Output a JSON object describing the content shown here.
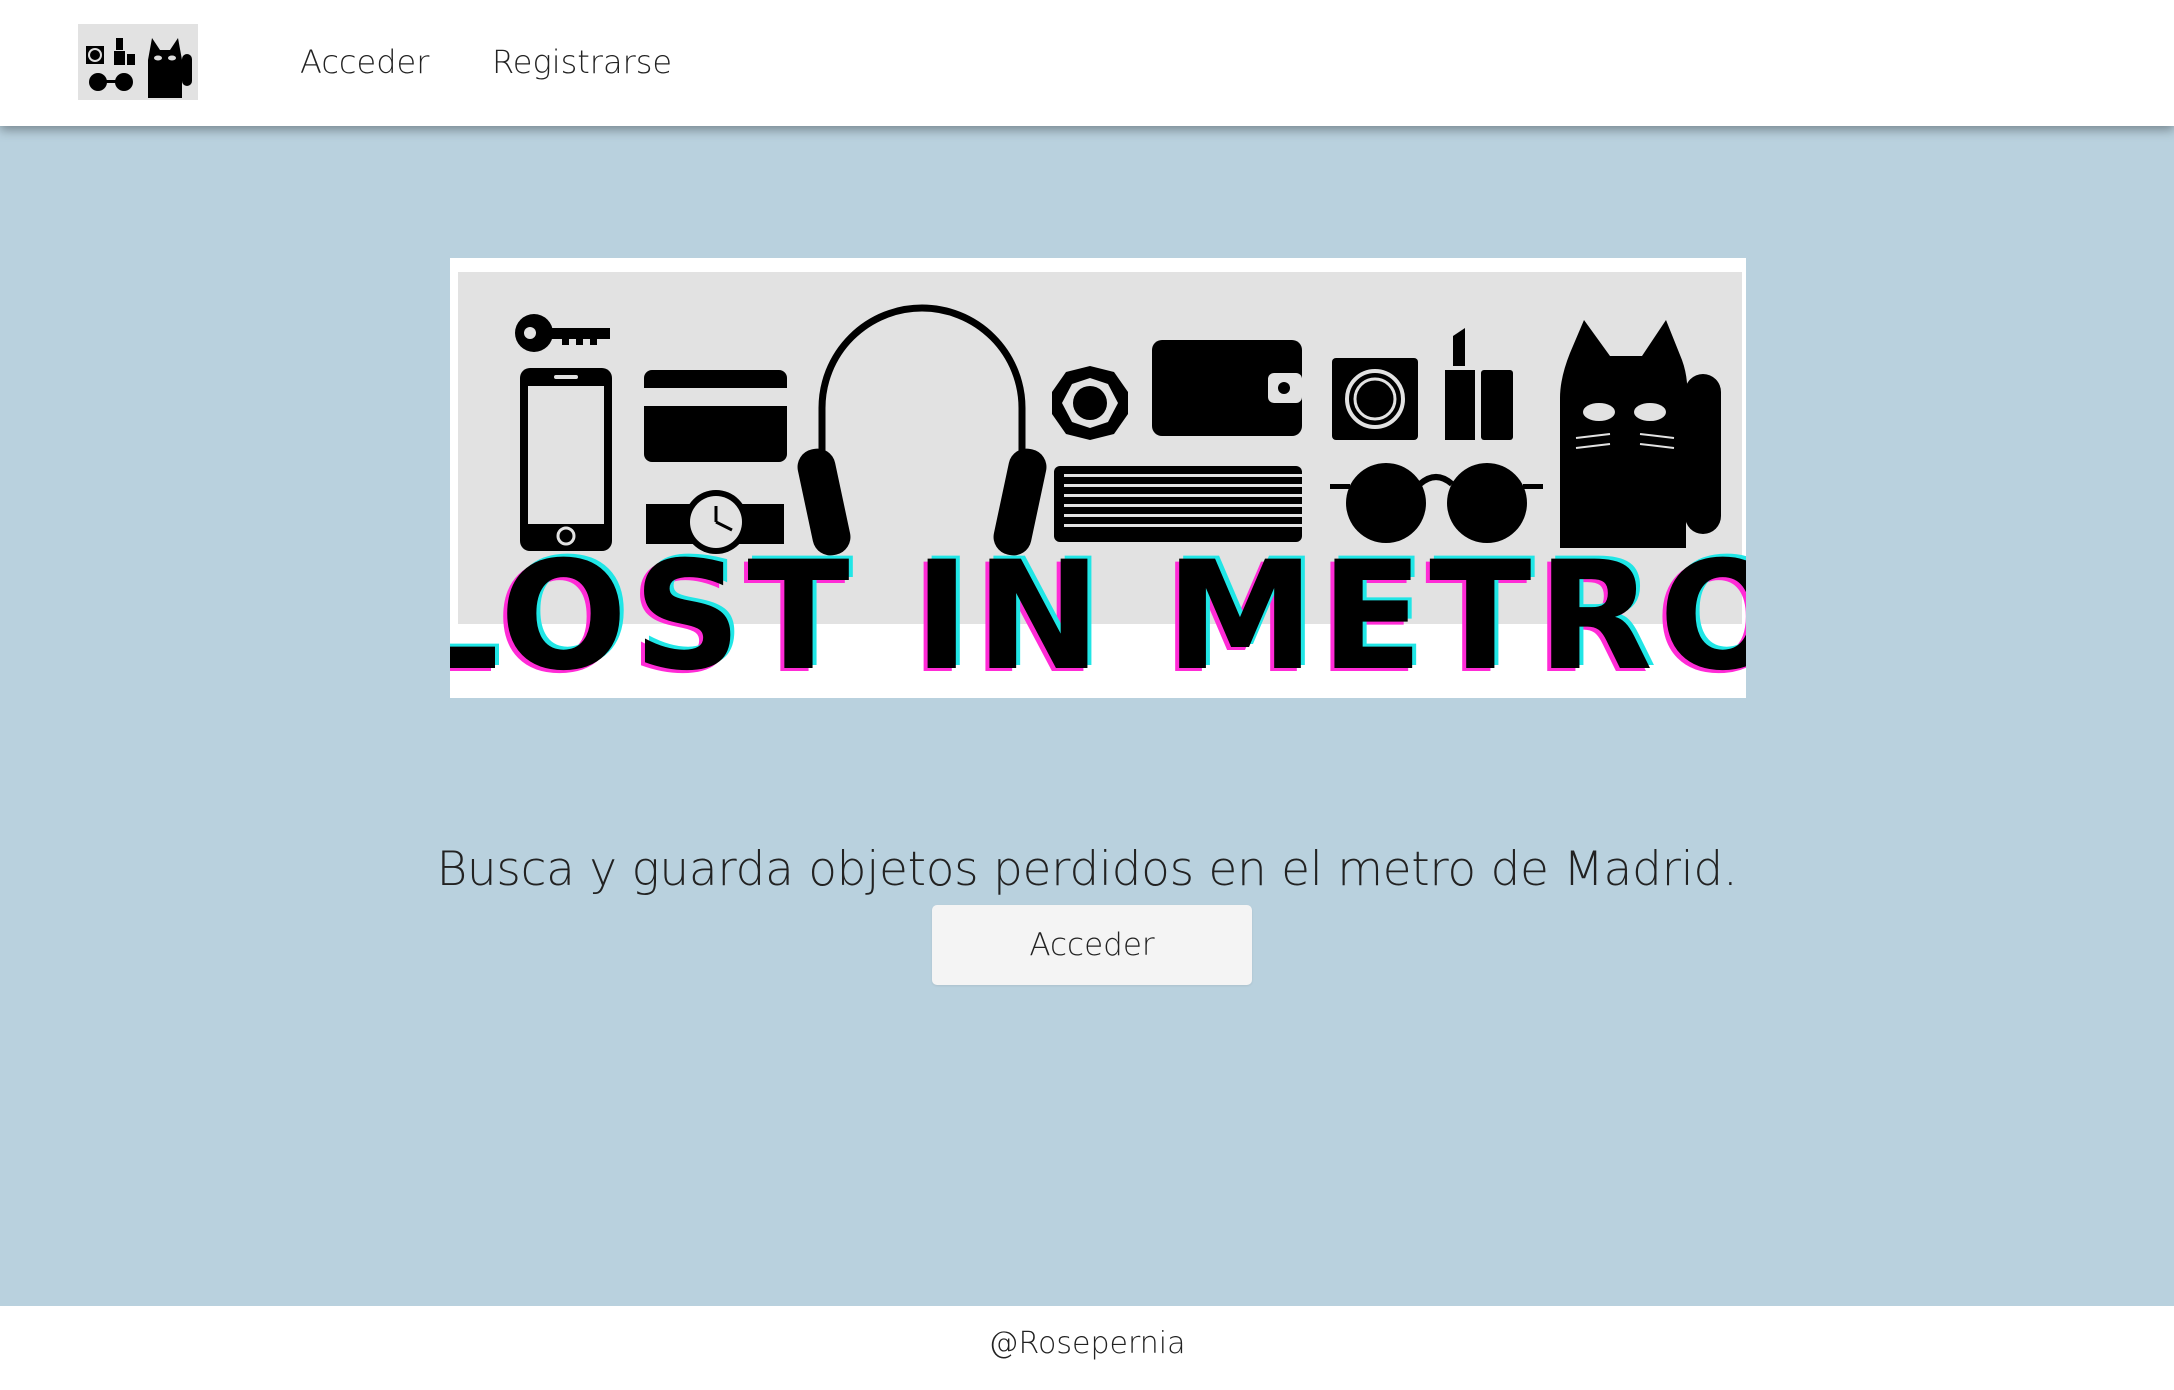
{
  "nav": {
    "logo_icon": "lost-items-icons-logo",
    "links": [
      {
        "label": "Acceder"
      },
      {
        "label": "Registrarse"
      }
    ]
  },
  "hero": {
    "banner_text": "LOST IN METRO",
    "banner_icons": [
      "key-icon",
      "phone-icon",
      "credit-card-icon",
      "watch-icon",
      "headphones-icon",
      "ring-icon",
      "wallet-icon",
      "book-icon",
      "condom-icon",
      "lipstick-icon",
      "glasses-icon",
      "cat-icon"
    ],
    "tagline": "Busca y guarda objetos perdidos en el metro de Madrid.",
    "cta_label": "Acceder"
  },
  "footer": {
    "text": "@Rosepernia"
  },
  "colors": {
    "background": "#b9d1de",
    "banner_text_glow_magenta": "#ff2bd6",
    "banner_text_glow_cyan": "#20e6e6"
  }
}
